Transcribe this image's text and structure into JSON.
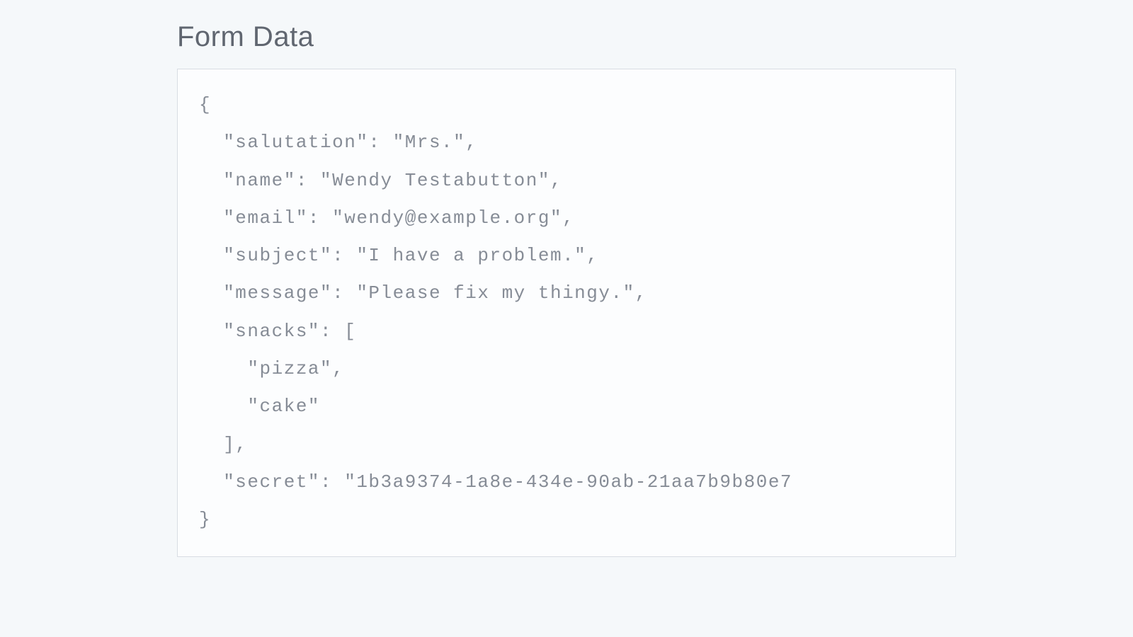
{
  "heading": "Form Data",
  "formData": {
    "salutation": "Mrs.",
    "name": "Wendy Testabutton",
    "email": "wendy@example.org",
    "subject": "I have a problem.",
    "message": "Please fix my thingy.",
    "snacks": [
      "pizza",
      "cake"
    ],
    "secret": "1b3a9374-1a8e-434e-90ab-21aa7b9b80e7"
  }
}
